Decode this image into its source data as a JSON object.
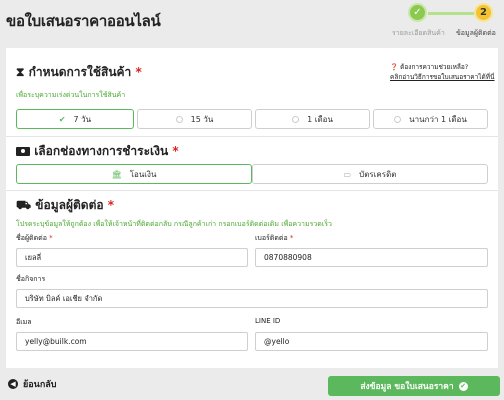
{
  "header": {
    "title": "ขอใบเสนอราคาออนไลน์",
    "steps": [
      {
        "label": "รายละเอียดสินค้า",
        "marker": "✓"
      },
      {
        "label": "ข้อมูลผู้ติดต่อ",
        "marker": "2"
      }
    ]
  },
  "usage": {
    "title": "กำหนดการใช้สินค้า",
    "required_mark": "*",
    "hint": "เพื่อระบุความเร่งด่วนในการใช้สินค้า",
    "help_question": "ต้องการความช่วยเหลือ?",
    "help_link": "คลิกอ่านวิธีการขอใบเสนอราคาได้ที่นี่",
    "options": [
      "7 วัน",
      "15 วัน",
      "1 เดือน",
      "นานกว่า 1 เดือน"
    ],
    "selected": "7 วัน"
  },
  "payment": {
    "title": "เลือกช่องทางการชำระเงิน",
    "required_mark": "*",
    "options": [
      "โอนเงิน",
      "บัตรเครดิต"
    ],
    "selected": "โอนเงิน"
  },
  "contact": {
    "title": "ข้อมูลผู้ติดต่อ",
    "required_mark": "*",
    "hint": "โปรดระบุข้อมูลให้ถูกต้อง เพื่อให้เจ้าหน้าที่ติดต่อกลับ กรณีลูกค้าเก่า กรอกเบอร์ติดต่อเดิม เพื่อความรวดเร็ว",
    "name_label": "ชื่อผู้ติดต่อ",
    "name_value": "เยลลี่",
    "phone_label": "เบอร์ติดต่อ",
    "phone_value": "0870880908",
    "company_label": "ชื่อกิจการ",
    "company_value": "บริษัท บิลค์ เอเชีย จำกัด",
    "email_label": "อีเมล",
    "email_value": "yelly@builk.com",
    "line_label": "LINE ID",
    "line_value": "@yello",
    "required_mark_small": "*"
  },
  "footer": {
    "back_label": "ย้อนกลับ",
    "submit_label": "ส่งข้อมูล ขอใบเสนอราคา"
  },
  "colors": {
    "accent_green": "#5cb85c",
    "step_yellow": "#f4c430",
    "required_red": "#e02020"
  }
}
